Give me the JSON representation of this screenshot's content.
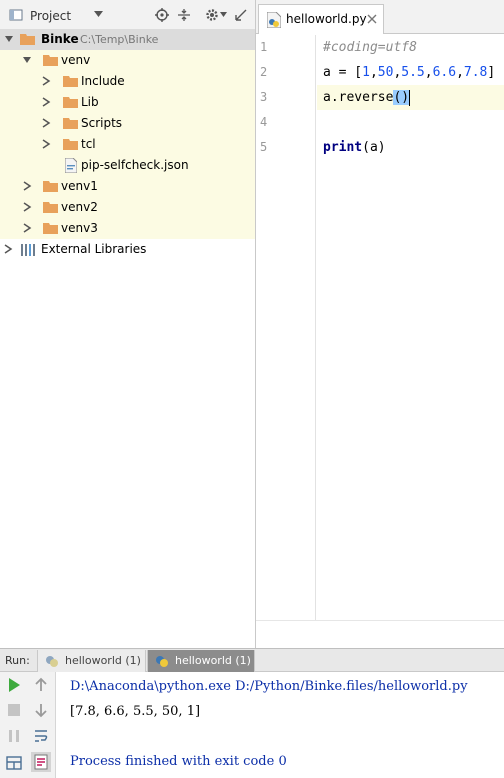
{
  "project_panel": {
    "title": "Project",
    "tree": {
      "root": {
        "name": "Binke",
        "path": "C:\\Temp\\Binke"
      },
      "venv": {
        "name": "venv",
        "children": [
          "Include",
          "Lib",
          "Scripts",
          "tcl"
        ],
        "file": "pip-selfcheck.json"
      },
      "siblings": [
        "venv1",
        "venv2",
        "venv3"
      ],
      "external": "External Libraries"
    }
  },
  "editor": {
    "tab_label": "helloworld.py",
    "line_numbers": [
      "1",
      "2",
      "3",
      "4",
      "5"
    ],
    "code": {
      "line1_comment": "#coding=utf8",
      "line2_prefix": "a = [",
      "line2_nums": [
        "1",
        "50",
        "5.5",
        "6.6",
        "7.8"
      ],
      "line2_suffix": "]",
      "line3_call": "a.reverse",
      "line3_parens": "()",
      "line5_keyword": "print",
      "line5_args": "(a)"
    }
  },
  "run_panel": {
    "label": "Run:",
    "tabs": [
      "helloworld (1)",
      "helloworld (1)"
    ],
    "console": [
      "D:\\Anaconda\\python.exe D:/Python/Binke.files/helloworld.py",
      "[7.8, 6.6, 5.5, 50, 1]",
      "",
      "Process finished with exit code 0"
    ]
  },
  "colors": {
    "highlight_row": "#fcfbe3",
    "folder": "#e8a15b",
    "run_green": "#3eaa3e",
    "number_blue": "#1750eb"
  }
}
